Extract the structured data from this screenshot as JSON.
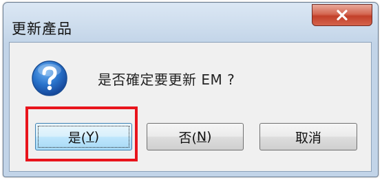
{
  "dialog": {
    "title": "更新產品",
    "message": "是否確定要更新 EM ?",
    "icon": "question-icon",
    "close_icon": "close-icon"
  },
  "buttons": {
    "yes": {
      "label": "是(",
      "mnemonic": "Y",
      "suffix": ")"
    },
    "no": {
      "label": "否(",
      "mnemonic": "N",
      "suffix": ")"
    },
    "cancel": {
      "label": "取消"
    }
  },
  "colors": {
    "highlight": "#e8141c",
    "close_button": "#c2402a",
    "icon_blue": "#1f64b8"
  }
}
